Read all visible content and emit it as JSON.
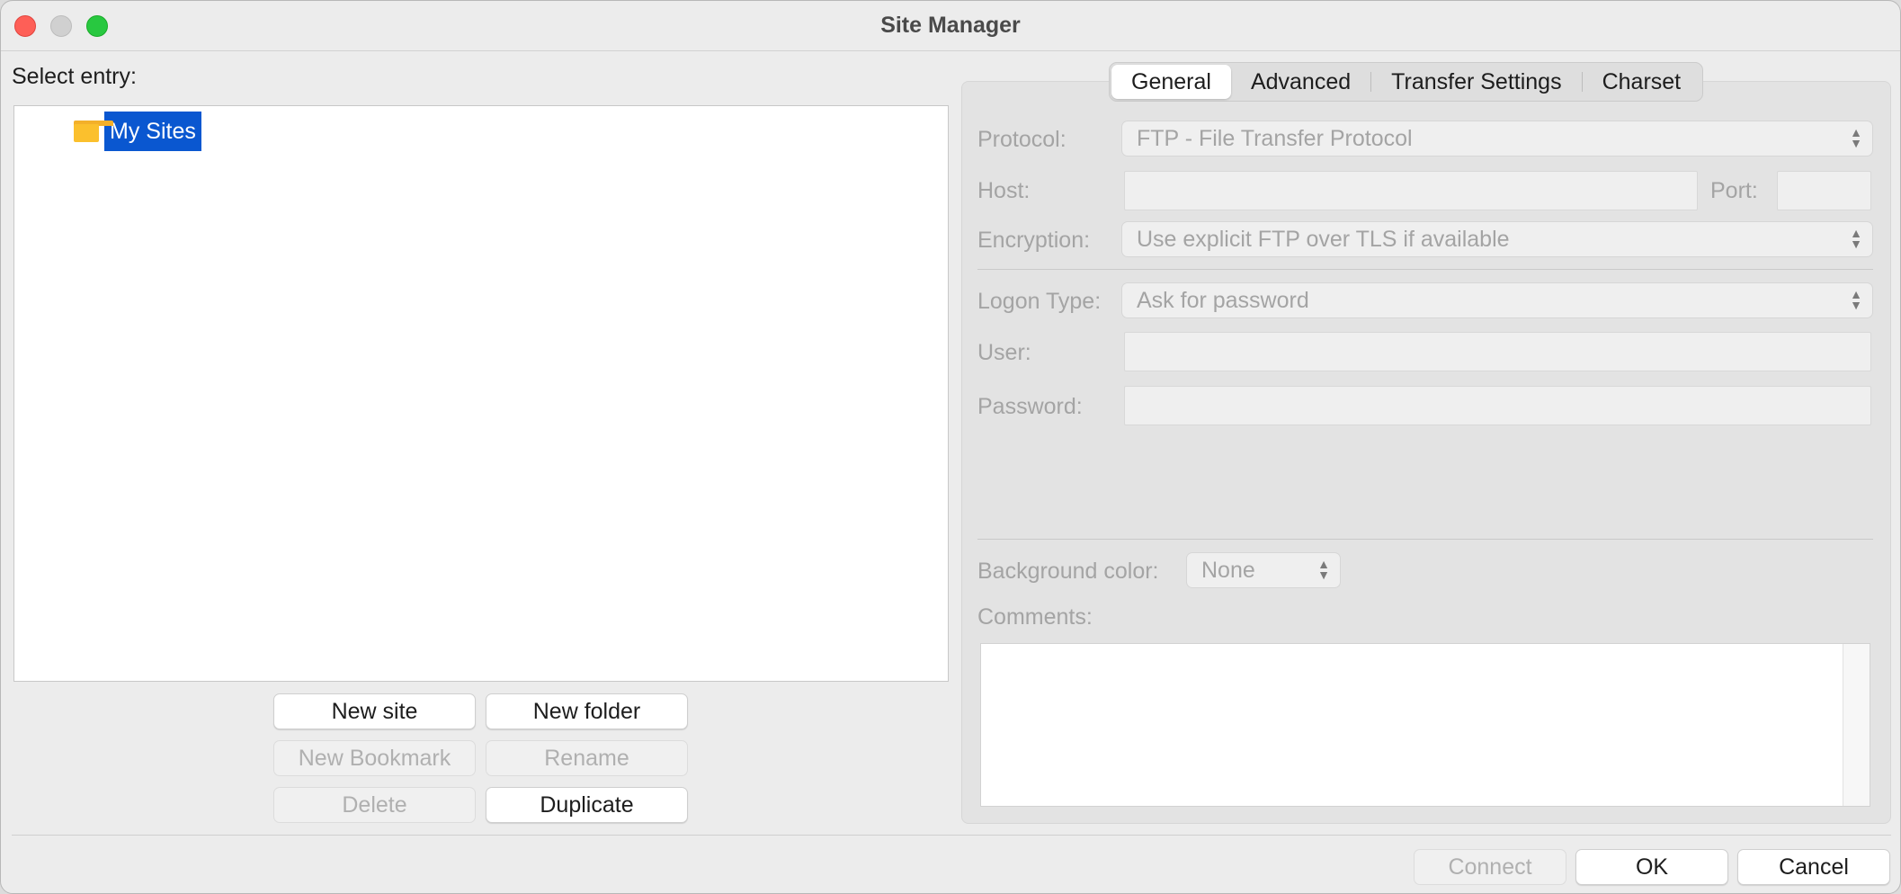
{
  "window": {
    "title": "Site Manager"
  },
  "left": {
    "select_label": "Select entry:",
    "tree": [
      {
        "label": "My Sites",
        "icon": "folder-icon",
        "selected": true
      }
    ],
    "buttons": {
      "new_site": "New site",
      "new_folder": "New folder",
      "new_bookmark": "New Bookmark",
      "rename": "Rename",
      "delete": "Delete",
      "duplicate": "Duplicate"
    }
  },
  "tabs": [
    "General",
    "Advanced",
    "Transfer Settings",
    "Charset"
  ],
  "active_tab": "General",
  "general": {
    "protocol_label": "Protocol:",
    "protocol_value": "FTP - File Transfer Protocol",
    "host_label": "Host:",
    "host_value": "",
    "port_label": "Port:",
    "port_value": "",
    "encryption_label": "Encryption:",
    "encryption_value": "Use explicit FTP over TLS if available",
    "logon_label": "Logon Type:",
    "logon_value": "Ask for password",
    "user_label": "User:",
    "user_value": "",
    "password_label": "Password:",
    "password_value": "",
    "bgcolor_label": "Background color:",
    "bgcolor_value": "None",
    "comments_label": "Comments:",
    "comments_value": ""
  },
  "footer": {
    "connect": "Connect",
    "ok": "OK",
    "cancel": "Cancel"
  },
  "colors": {
    "selection": "#0a57d0",
    "close": "#fe5f57",
    "zoom": "#28c840",
    "folder": "#fbc02d"
  }
}
